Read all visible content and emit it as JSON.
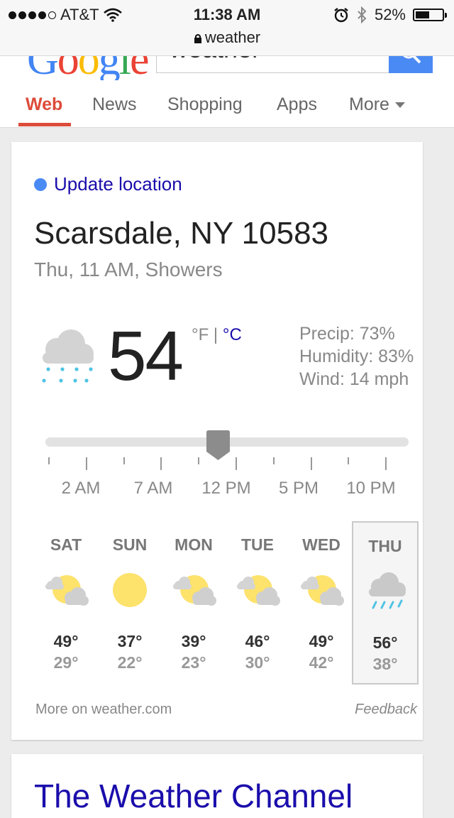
{
  "status_bar": {
    "carrier": "AT&T",
    "signal_bars_filled": 4,
    "signal_bars_total": 5,
    "time": "11:38 AM",
    "url": "weather",
    "battery": "52%",
    "battery_level": 0.52
  },
  "google": {
    "logo": "Google",
    "search_query": "weather"
  },
  "tabs": [
    {
      "label": "Web",
      "active": true
    },
    {
      "label": "News"
    },
    {
      "label": "Shopping"
    },
    {
      "label": "Apps"
    },
    {
      "label": "More"
    }
  ],
  "weather": {
    "update_location": "Update location",
    "location": "Scarsdale, NY 10583",
    "condition": "Thu, 11 AM, Showers",
    "temperature": "54",
    "unit_f": "°F",
    "unit_sep": " | ",
    "unit_c": "°C",
    "precip": "Precip: 73%",
    "humidity": "Humidity: 83%",
    "wind": "Wind: 14 mph",
    "hour_labels": [
      "2 AM",
      "7 AM",
      "12 PM",
      "5 PM",
      "10 PM"
    ],
    "forecast": [
      {
        "day": "SAT",
        "hi": "49°",
        "lo": "29°",
        "icon": "partly-cloudy-icon"
      },
      {
        "day": "SUN",
        "hi": "37°",
        "lo": "22°",
        "icon": "sunny-icon"
      },
      {
        "day": "MON",
        "hi": "39°",
        "lo": "23°",
        "icon": "partly-cloudy-icon"
      },
      {
        "day": "TUE",
        "hi": "46°",
        "lo": "30°",
        "icon": "partly-cloudy-icon"
      },
      {
        "day": "WED",
        "hi": "49°",
        "lo": "42°",
        "icon": "partly-cloudy-icon"
      },
      {
        "day": "THU",
        "hi": "56°",
        "lo": "38°",
        "icon": "rain-icon",
        "selected": true
      }
    ],
    "more_link": "More on weather.com",
    "feedback": "Feedback"
  },
  "next_result": {
    "title": "The Weather Channel"
  }
}
